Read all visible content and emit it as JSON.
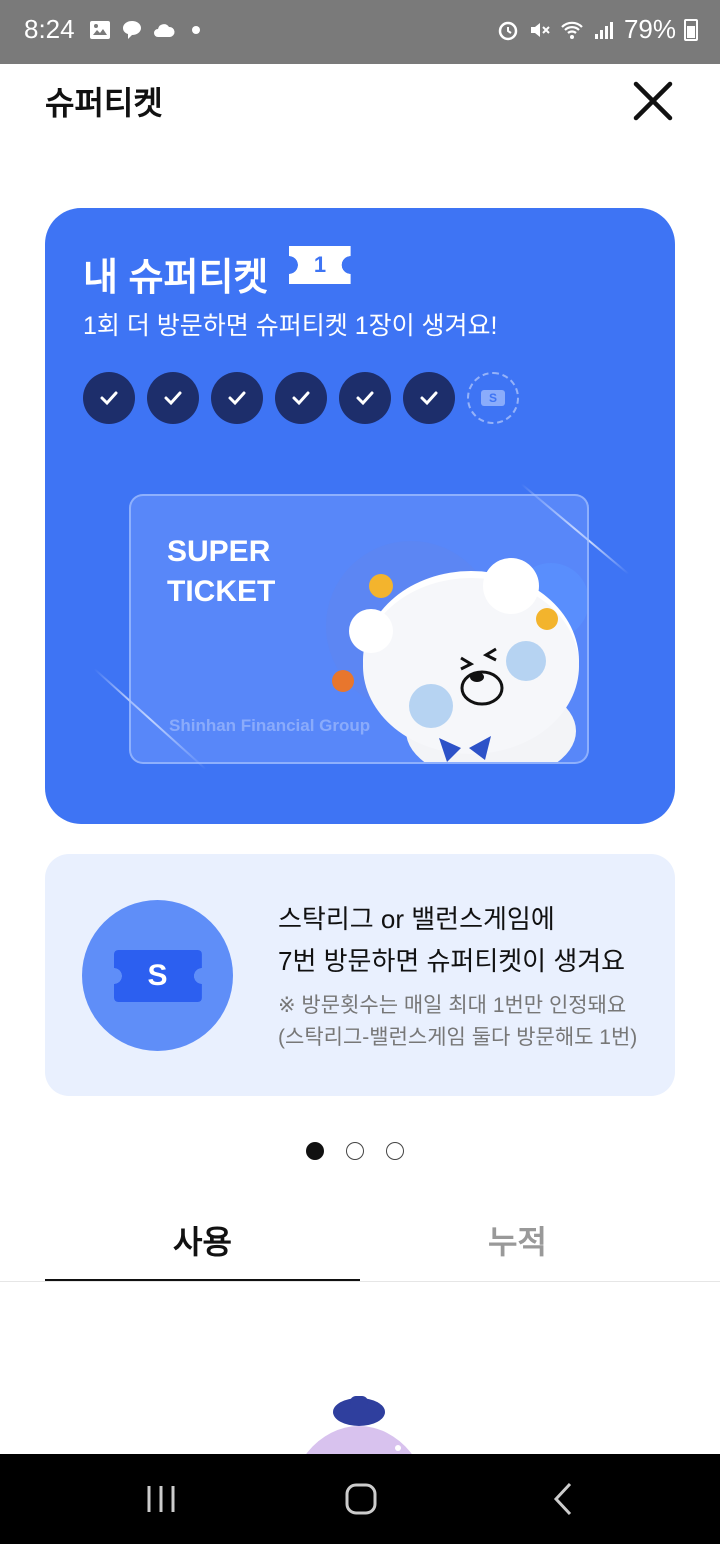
{
  "status_bar": {
    "time": "8:24",
    "battery": "79%",
    "icons_left": [
      "gallery-icon",
      "chat-icon",
      "cloud-icon",
      "dot-icon"
    ],
    "icons_right": [
      "alarm-icon",
      "mute-icon",
      "wifi-icon",
      "signal-icon",
      "battery-icon"
    ]
  },
  "header": {
    "title": "슈퍼티켓",
    "close_icon": "close-icon"
  },
  "ticket_card": {
    "title": "내 슈퍼티켓",
    "count": "1",
    "subtitle": "1회 더 방문하면 슈퍼티켓 1장이 생겨요!",
    "stamps_filled": 6,
    "stamps_total": 7,
    "stamp_placeholder": "S",
    "visual": {
      "title": "SUPER TICKET",
      "brand": "Shinhan Financial Group"
    }
  },
  "info_card": {
    "ticket_letter": "S",
    "line1": "스탁리그 or 밸런스게임에",
    "line2": "7번 방문하면 슈퍼티켓이 생겨요",
    "note1": "※ 방문횟수는 매일 최대 1번만 인정돼요",
    "note2": "(스탁리그-밸런스게임 둘다 방문해도 1번)"
  },
  "pagination": {
    "total": 3,
    "active": 1
  },
  "tabs": [
    {
      "label": "사용",
      "active": true
    },
    {
      "label": "누적",
      "active": false
    }
  ],
  "colors": {
    "card_blue": "#3e74f4",
    "stamp_navy": "#1d2e6b",
    "info_bg": "#e9f0fe",
    "info_circle": "#5f8ef8"
  },
  "nav_bar": [
    "recent-apps-icon",
    "home-icon",
    "back-icon"
  ]
}
